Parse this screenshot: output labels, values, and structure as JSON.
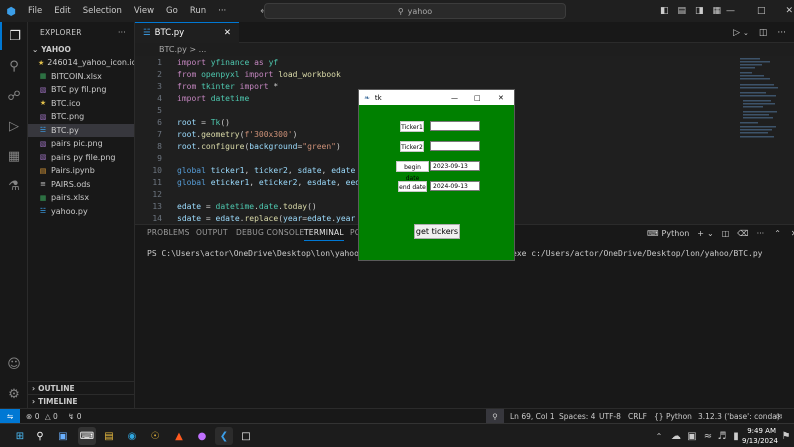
{
  "titlebar": {
    "menu": [
      "File",
      "Edit",
      "Selection",
      "View",
      "Go",
      "Run",
      "···"
    ],
    "search": "yahoo"
  },
  "explorer": {
    "header": "EXPLORER",
    "folder": "YAHOO",
    "files": [
      {
        "name": "246014_yahoo_icon.ico",
        "icon": "star-icon",
        "color": "#e2c04a"
      },
      {
        "name": "BITCOIN.xlsx",
        "icon": "table-icon",
        "color": "#3aa35b"
      },
      {
        "name": "BTC py fil.png",
        "icon": "image-icon",
        "color": "#a074c4"
      },
      {
        "name": "BTC.ico",
        "icon": "star-icon",
        "color": "#e2c04a"
      },
      {
        "name": "BTC.png",
        "icon": "image-icon",
        "color": "#a074c4"
      },
      {
        "name": "BTC.py",
        "icon": "python-icon",
        "color": "#3b9ee8"
      },
      {
        "name": "pairs pic.png",
        "icon": "image-icon",
        "color": "#a074c4"
      },
      {
        "name": "pairs py file.png",
        "icon": "image-icon",
        "color": "#a074c4"
      },
      {
        "name": "Pairs.ipynb",
        "icon": "notebook-icon",
        "color": "#e8a23b"
      },
      {
        "name": "PAIRS.ods",
        "icon": "file-icon",
        "color": "#cccccc"
      },
      {
        "name": "pairs.xlsx",
        "icon": "table-icon",
        "color": "#3aa35b"
      },
      {
        "name": "yahoo.py",
        "icon": "python-icon",
        "color": "#3b9ee8"
      }
    ],
    "outline": "OUTLINE",
    "timeline": "TIMELINE"
  },
  "editor": {
    "tab": "BTC.py",
    "breadcrumb": "BTC.py > ...",
    "lines": [
      {
        "n": "1",
        "html": "<span class='kw'>import</span> <span class='cls'>yfinance</span> <span class='kw'>as</span> <span class='cls'>yf</span>"
      },
      {
        "n": "2",
        "html": "<span class='kw'>from</span> <span class='cls'>openpyxl</span> <span class='kw'>import</span> <span class='fn'>load_workbook</span>"
      },
      {
        "n": "3",
        "html": "<span class='kw'>from</span> <span class='cls'>tkinter</span> <span class='kw'>import</span> *"
      },
      {
        "n": "4",
        "html": "<span class='kw'>import</span> <span class='cls'>datetime</span>"
      },
      {
        "n": "5",
        "html": ""
      },
      {
        "n": "6",
        "html": "<span class='var'>root</span> = <span class='cls'>Tk</span>()"
      },
      {
        "n": "7",
        "html": "<span class='var'>root</span>.<span class='fn'>geometry</span>(<span class='str'>f'300x300'</span>)"
      },
      {
        "n": "8",
        "html": "<span class='var'>root</span>.<span class='fn'>configure</span>(<span class='var'>background</span>=<span class='str'>\"green\"</span>)"
      },
      {
        "n": "9",
        "html": ""
      },
      {
        "n": "10",
        "html": "<span class='kw2'>global</span> <span class='var'>ticker1</span>, <span class='var'>ticker2</span>, <span class='var'>sdate</span>, <span class='var'>edate</span>"
      },
      {
        "n": "11",
        "html": "<span class='kw2'>global</span> <span class='var'>eticker1</span>, <span class='var'>eticker2</span>, <span class='var'>esdate</span>, <span class='var'>eed</span>"
      },
      {
        "n": "12",
        "html": ""
      },
      {
        "n": "13",
        "html": "<span class='var'>edate</span> = <span class='cls'>datetime</span>.<span class='cls'>date</span>.<span class='fn'>today</span>()"
      },
      {
        "n": "14",
        "html": "<span class='var'>sdate</span> = <span class='var'>edate</span>.<span class='fn'>replace</span>(<span class='var'>year</span>=<span class='var'>edate</span>.<span class='var'>year</span>"
      }
    ]
  },
  "panel": {
    "tabs": [
      "PROBLEMS",
      "OUTPUT",
      "DEBUG CONSOLE",
      "TERMINAL",
      "PO"
    ],
    "shell": "Python",
    "terminal_left": "PS C:\\Users\\actor\\OneDrive\\Desktop\\lon\\yahoo> &",
    "terminal_right": "exe c:/Users/actor/OneDrive/Desktop/lon/yahoo/BTC.py"
  },
  "statusbar": {
    "errors": "0",
    "warnings": "0",
    "ports": "0",
    "position": "Ln 69, Col 1",
    "spaces": "Spaces: 4",
    "encoding": "UTF-8",
    "eol": "CRLF",
    "language": "Python",
    "interpreter": "3.12.3 ('base': conda)"
  },
  "tk": {
    "title": "tk",
    "ticker1_label": "Ticker1",
    "ticker2_label": "Ticker2",
    "begin_label": "begin date",
    "end_label": "end date",
    "begin_value": "2023-09-13",
    "end_value": "2024-09-13",
    "button": "get tickers"
  },
  "taskbar": {
    "time": "9:49 AM",
    "date": "9/13/2024"
  }
}
